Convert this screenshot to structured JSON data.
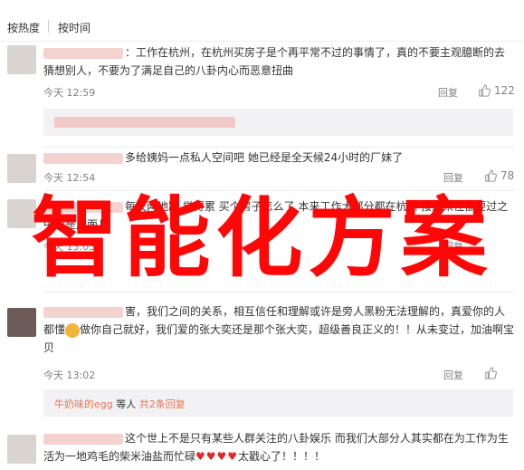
{
  "tabs": {
    "hot": "按热度",
    "time": "按时间"
  },
  "comments": [
    {
      "text": "：工作在杭州，在杭州买房子是个再平常不过的事情了，真的不要主观臆断的去猜想别人，不要为了满足自己的八卦内心而恶意扭曲",
      "time": "今天 12:59",
      "reply": "回复",
      "likes": "122"
    },
    {
      "text": "多给姨妈一点私人空间吧 她已经是全天候24小时的厂妹了",
      "time": "今天 12:54",
      "reply": "回复",
      "likes": "78"
    },
    {
      "text": "每天两地跑 觉得累 买个房子怎么了 本来工作大部分都在杭州 接过来住都要过之中要是后面几",
      "time": "今天 13:03",
      "reply": "回复",
      "likes": ""
    },
    {
      "text": "害，我们之间的关系，相互信任和理解或许是旁人黑粉无法理解的，真爱你的人都懂",
      "text2": "做你自己就好，我们爱的张大奕还是那个张大奕，超级善良正义的！！从未变过，加油啊宝贝",
      "time": "今天 13:02",
      "reply": "回复",
      "likes": ""
    },
    {
      "text": "这个世上不是只有某些人群关注的八卦娱乐 而我们大部分人其实都在为工作为生活为一地鸡毛的柴米油盐而忙碌",
      "text2": "太戳心了！！！！",
      "time": "",
      "reply": "",
      "likes": ""
    }
  ],
  "subreply": {
    "user": "牛奶味的egg",
    "mid": " 等人 ",
    "count": "共2条回复"
  },
  "overlay": "智能化方案",
  "colors": {
    "overlay": "#ff0000",
    "link": "#eb7350"
  }
}
